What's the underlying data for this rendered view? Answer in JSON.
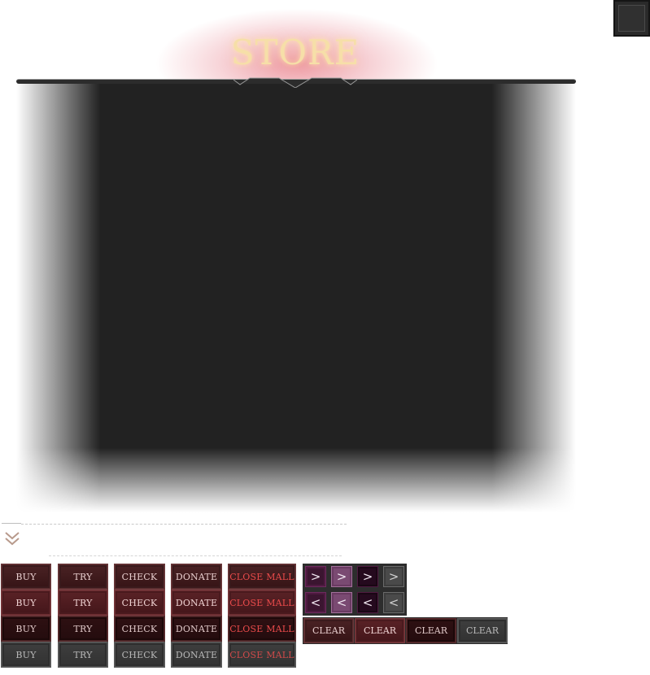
{
  "store": {
    "title": "STORE"
  },
  "buttons": {
    "buy": "BUY",
    "try": "TRY",
    "check": "CHECK",
    "donate": "DONATE",
    "close_mall": "CLOSE MALL",
    "clear": "CLEAR",
    "next": ">",
    "prev": "<"
  },
  "button_states": [
    "normal",
    "hover",
    "pressed",
    "disabled"
  ],
  "colors": {
    "title_gold": "#f6dfa8",
    "panel_bg": "#222222",
    "button_red": "#4a2224",
    "close_text": "#ea4b4b",
    "arrow_purple": "#3b1530"
  },
  "icons": {
    "collapse": "double-chevron-down-icon"
  }
}
